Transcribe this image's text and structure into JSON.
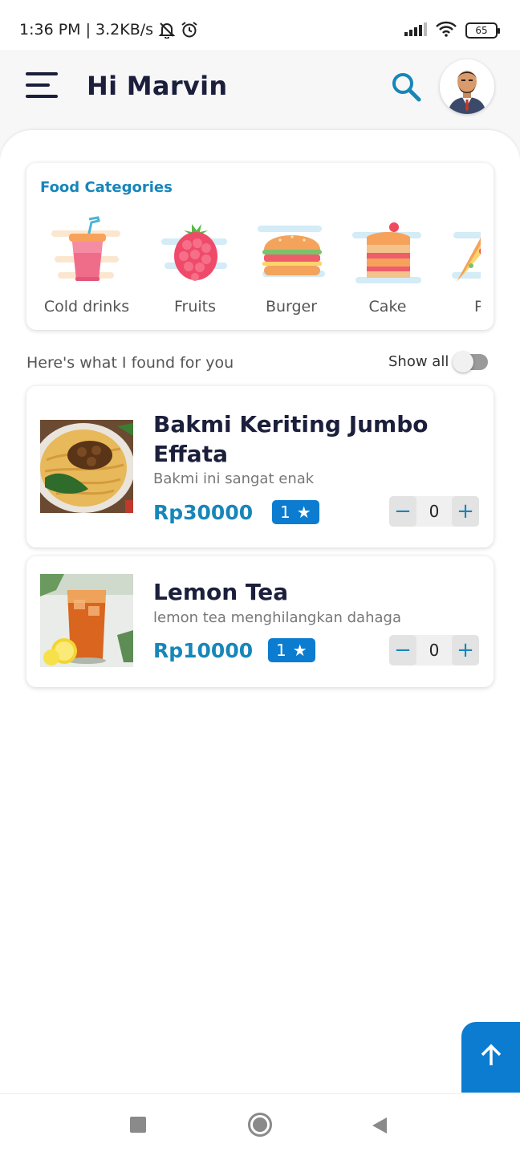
{
  "status_bar": {
    "time_speed": "1:36 PM | 3.2KB/s",
    "battery": "65"
  },
  "header": {
    "greeting": "Hi Marvin"
  },
  "categories": {
    "title": "Food Categories",
    "items": [
      {
        "label": "Cold drinks",
        "icon": "cold-drink-icon"
      },
      {
        "label": "Fruits",
        "icon": "raspberry-icon"
      },
      {
        "label": "Burger",
        "icon": "burger-icon"
      },
      {
        "label": "Cake",
        "icon": "cake-icon"
      },
      {
        "label": "Pi",
        "icon": "pizza-icon"
      }
    ]
  },
  "results": {
    "heading": "Here's what I found for you",
    "show_all_label": "Show all",
    "show_all_on": false
  },
  "foods": [
    {
      "name_line1": "Bakmi Keriting Jumbo",
      "name_line2": "Effata",
      "description": "Bakmi ini sangat enak",
      "price": "Rp30000",
      "rating": "1",
      "quantity": "0"
    },
    {
      "name_line1": "Lemon Tea",
      "description": "lemon tea menghilangkan dahaga",
      "price": "Rp10000",
      "rating": "1",
      "quantity": "0"
    }
  ],
  "colors": {
    "accent": "#1786b9",
    "badge": "#0b7cd0",
    "title_text": "#1b1f3b"
  }
}
